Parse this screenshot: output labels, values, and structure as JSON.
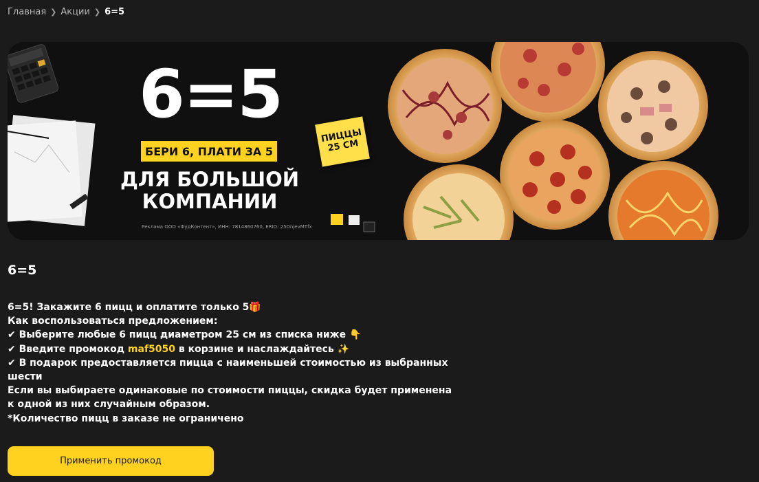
{
  "breadcrumb": {
    "home": "Главная",
    "promos": "Акции",
    "current": "6=5"
  },
  "banner": {
    "title": "6=5",
    "tag": "БЕРИ 6, ПЛАТИ ЗА 5",
    "sub_line1": "ДЛЯ БОЛЬШОЙ",
    "sub_line2": "КОМПАНИИ",
    "sticker_line1": "ПИЦЦЫ",
    "sticker_line2": "25 СМ",
    "ad_note": "Реклама ООО «ФудКонтент», ИНН: 7814860760, ERID: 25DnjevMTfx"
  },
  "page": {
    "title": "6=5"
  },
  "description": {
    "line1": "6=5! Закажите 6 пицц и оплатите только 5🎁",
    "line2": "Как воспользоваться предложением:",
    "line3": "✔ Выберите любые 6 пицц диаметром 25 см из списка ниже 👇",
    "line4_before": "✔ Введите промокод ",
    "promo_code": "maf5050",
    "line4_after": " в корзине и наслаждайтесь ✨",
    "line5": "✔ В подарок предоставляется пицца с наименьшей стоимостью из выбранных шести",
    "line6": "Если вы выбираете одинаковые по стоимости пиццы, скидка будет применена к одной из них случайным образом.",
    "line7": "*Количество пицц в заказе не ограничено"
  },
  "cta": {
    "label": "Применить промокод"
  },
  "colors": {
    "background": "#1b1b1b",
    "accent": "#ffd21f"
  }
}
